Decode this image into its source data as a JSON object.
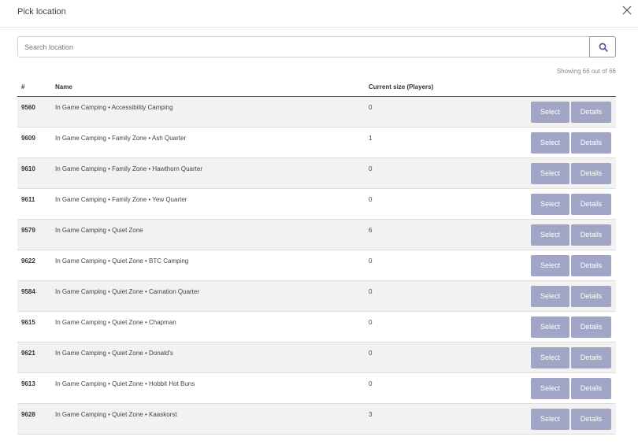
{
  "modal": {
    "title": "Pick location"
  },
  "search": {
    "placeholder": "Search location",
    "value": ""
  },
  "summary": "Showing 66 out of 66",
  "table": {
    "headers": {
      "id": "#",
      "name": "Name",
      "size": "Current size (Players)"
    },
    "select_label": "Select",
    "details_label": "Details",
    "rows": [
      {
        "id": "9560",
        "name": "In Game Camping • Accessibility Camping",
        "size": "0"
      },
      {
        "id": "9609",
        "name": "In Game Camping • Family Zone • Ash Quarter",
        "size": "1"
      },
      {
        "id": "9610",
        "name": "In Game Camping • Family Zone • Hawthorn Quarter",
        "size": "0"
      },
      {
        "id": "9611",
        "name": "In Game Camping • Family Zone • Yew Quarter",
        "size": "0"
      },
      {
        "id": "9579",
        "name": "In Game Camping • Quiet Zone",
        "size": "6"
      },
      {
        "id": "9622",
        "name": "In Game Camping • Quiet Zone • BTC Camping",
        "size": "0"
      },
      {
        "id": "9584",
        "name": "In Game Camping • Quiet Zone • Carnation Quarter",
        "size": "0"
      },
      {
        "id": "9615",
        "name": "In Game Camping • Quiet Zone • Chapman",
        "size": "0"
      },
      {
        "id": "9621",
        "name": "In Game Camping • Quiet Zone • Donald's",
        "size": "0"
      },
      {
        "id": "9613",
        "name": "In Game Camping • Quiet Zone • Hobbit Hot Buns",
        "size": "0"
      },
      {
        "id": "9628",
        "name": "In Game Camping • Quiet Zone • Kaaskorst",
        "size": "3"
      }
    ]
  },
  "colors": {
    "button_bg": "#a1a6c6",
    "row_stripe": "#f2f2f2"
  },
  "icons": {
    "close": "close-icon",
    "search": "search-icon"
  }
}
